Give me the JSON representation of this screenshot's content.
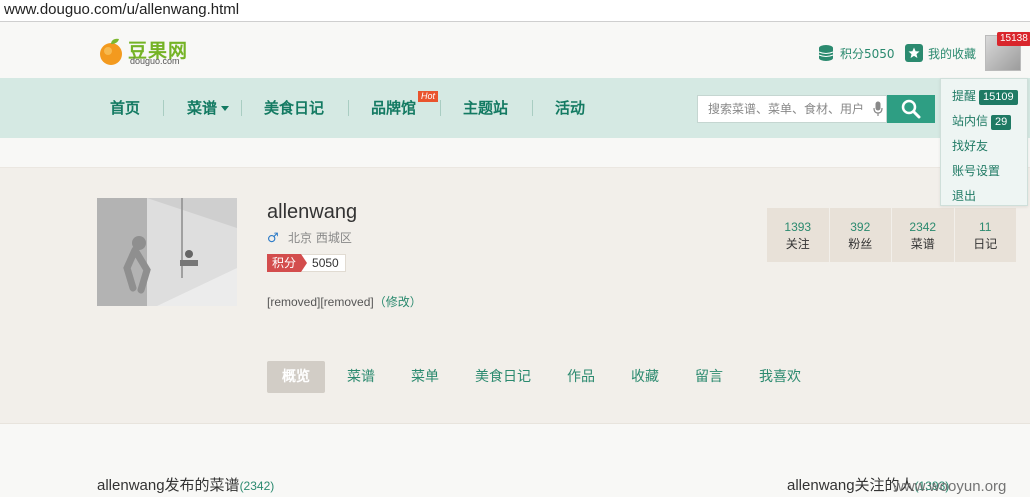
{
  "browser": {
    "url": "www.douguo.com/u/allenwang.html"
  },
  "header": {
    "logo_cn": "豆果网",
    "logo_en": "douguo.com",
    "points_label": "积分5050",
    "favorites_label": "我的收藏",
    "avatar_badge": "15138"
  },
  "nav": {
    "items": [
      "首页",
      "菜谱",
      "美食日记",
      "品牌馆",
      "主题站",
      "活动"
    ],
    "hot_badge": "Hot",
    "search_placeholder": "搜索菜谱、菜单、食材、用户"
  },
  "user_menu": {
    "remind_label": "提醒",
    "remind_count": "15109",
    "message_label": "站内信",
    "message_count": "29",
    "find_friends": "找好友",
    "account_settings": "账号设置",
    "logout": "退出"
  },
  "profile": {
    "username": "allenwang",
    "gender_icon": "male-icon",
    "location": "北京 西城区",
    "points_label": "积分",
    "points_value": "5050",
    "intro": "[removed][removed]",
    "edit_label": "（修改）",
    "stats": [
      {
        "num": "1393",
        "label": "关注"
      },
      {
        "num": "392",
        "label": "粉丝"
      },
      {
        "num": "2342",
        "label": "菜谱"
      },
      {
        "num": "11",
        "label": "日记"
      }
    ],
    "tabs": [
      "概览",
      "菜谱",
      "菜单",
      "美食日记",
      "作品",
      "收藏",
      "留言",
      "我喜欢"
    ]
  },
  "sections": {
    "recipes_title": "allenwang发布的菜谱",
    "recipes_count": "(2342)",
    "following_title": "allenwang关注的人",
    "following_count": "(1393)"
  },
  "watermark": "www.wooyun.org",
  "colors": {
    "brand_green": "#2b8a6f",
    "nav_bg": "#d5e9e3",
    "hot_red": "#e9542d",
    "points_red": "#d34d4d"
  }
}
